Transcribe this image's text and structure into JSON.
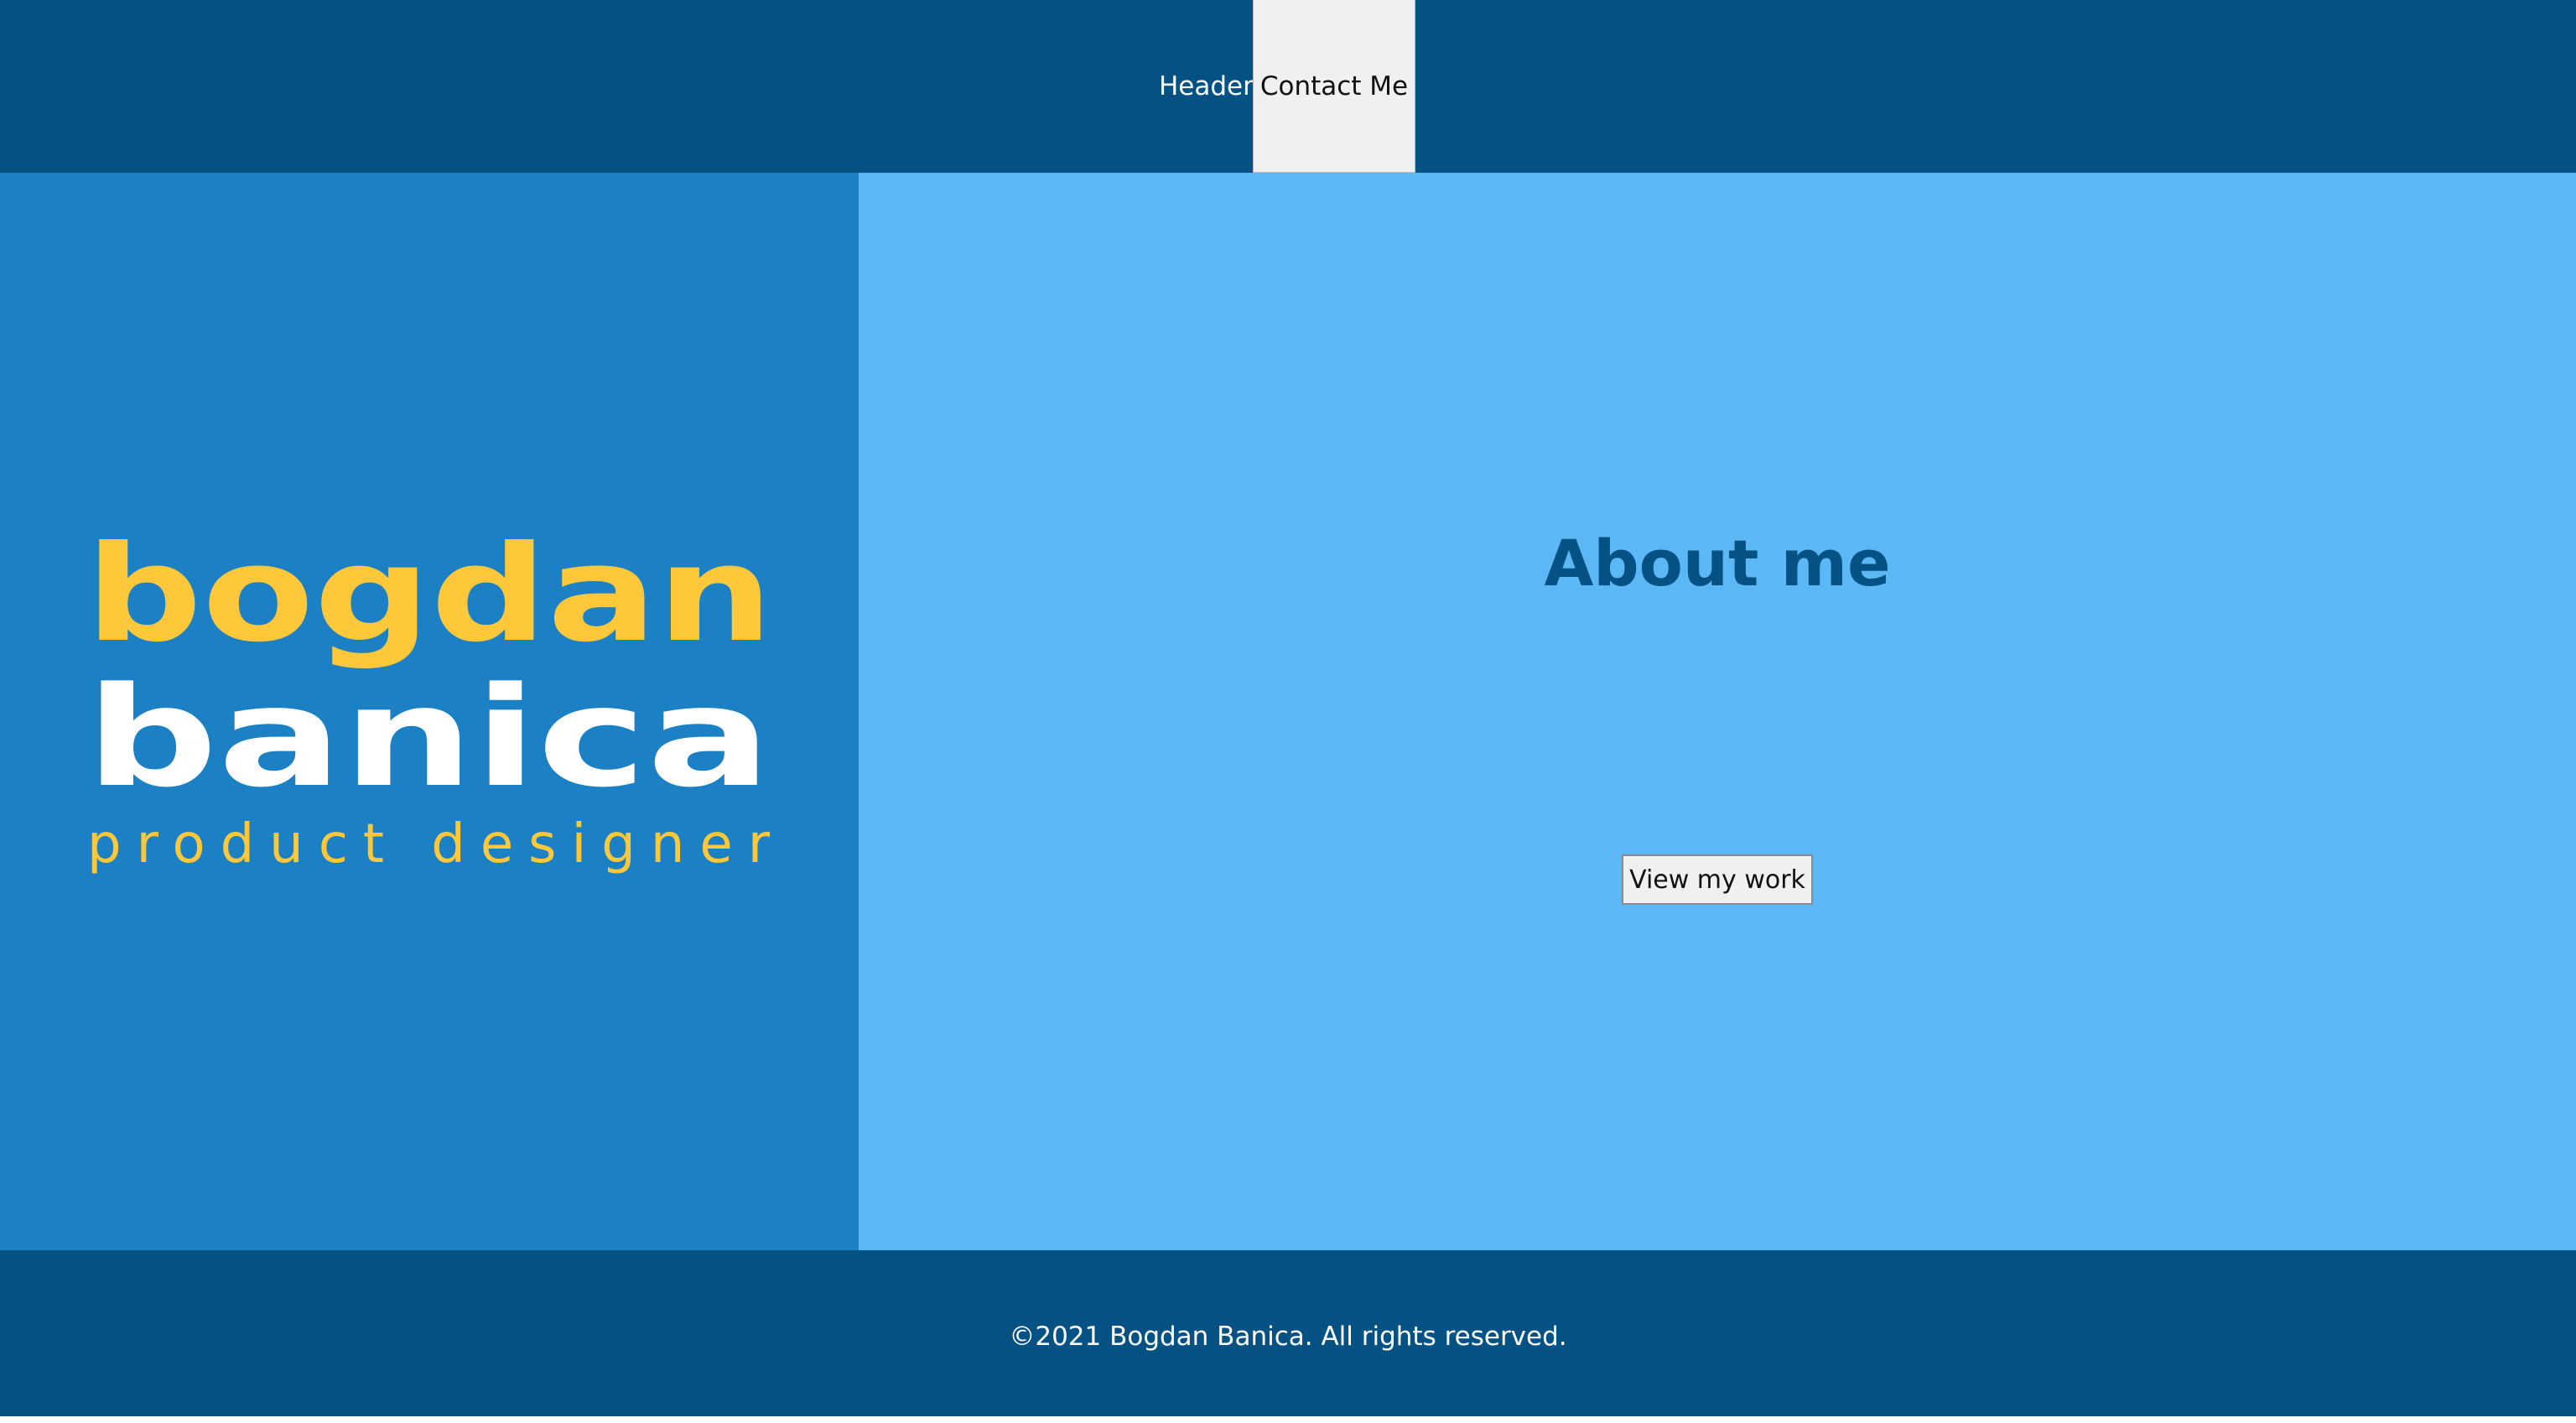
{
  "header": {
    "label": "Header",
    "contact_button_label": "Contact Me"
  },
  "logo": {
    "line1": "bogdan",
    "line2": "banica",
    "tagline": "product designer",
    "colors": {
      "accent": "#fec83a",
      "text": "#ffffff"
    }
  },
  "about": {
    "title": "About me",
    "view_work_button_label": "View my work"
  },
  "footer": {
    "copyright": "©2021 Bogdan Banica. All rights reserved."
  },
  "colors": {
    "header_bg": "#045184",
    "left_panel_bg": "#1b81c4",
    "right_panel_bg": "#5cb8f4",
    "footer_bg": "#045184",
    "title_color": "#045184",
    "button_bg": "#f0f0f0"
  }
}
